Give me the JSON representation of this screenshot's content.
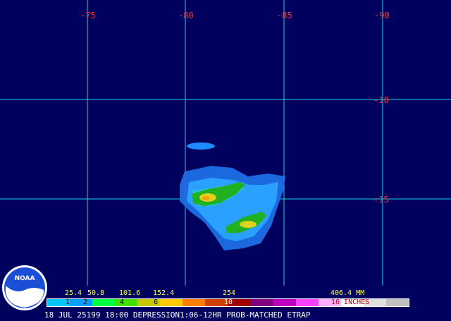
{
  "map": {
    "lon_labels": [
      "-75",
      "-80",
      "-85",
      "-90"
    ],
    "lat_labels": [
      "-10",
      "-15"
    ],
    "grid_color": "#20d0e0",
    "background": "#00005f",
    "label_color": "#ff3030"
  },
  "legend": {
    "mm_labels": [
      "25.4",
      "50.8",
      "101.6",
      "152.4",
      "254",
      "406.4 MM"
    ],
    "inch_labels": [
      "1",
      "2",
      "4",
      "6",
      "10",
      "16 INCHES"
    ],
    "colors": [
      "#00c8ff",
      "#00a0ff",
      "#00ff40",
      "#40e000",
      "#c8c800",
      "#ffc800",
      "#ff8000",
      "#d04000",
      "#a00000",
      "#800080",
      "#c000c0",
      "#ff40ff",
      "#ffb0ff",
      "#ffffff",
      "#e0e0e0",
      "#c0c0c0"
    ]
  },
  "caption": "18 JUL 25199 18:00 DEPRESSION1:06-12HR PROB-MATCHED ETRAP",
  "logo": {
    "text": "NOAA"
  }
}
